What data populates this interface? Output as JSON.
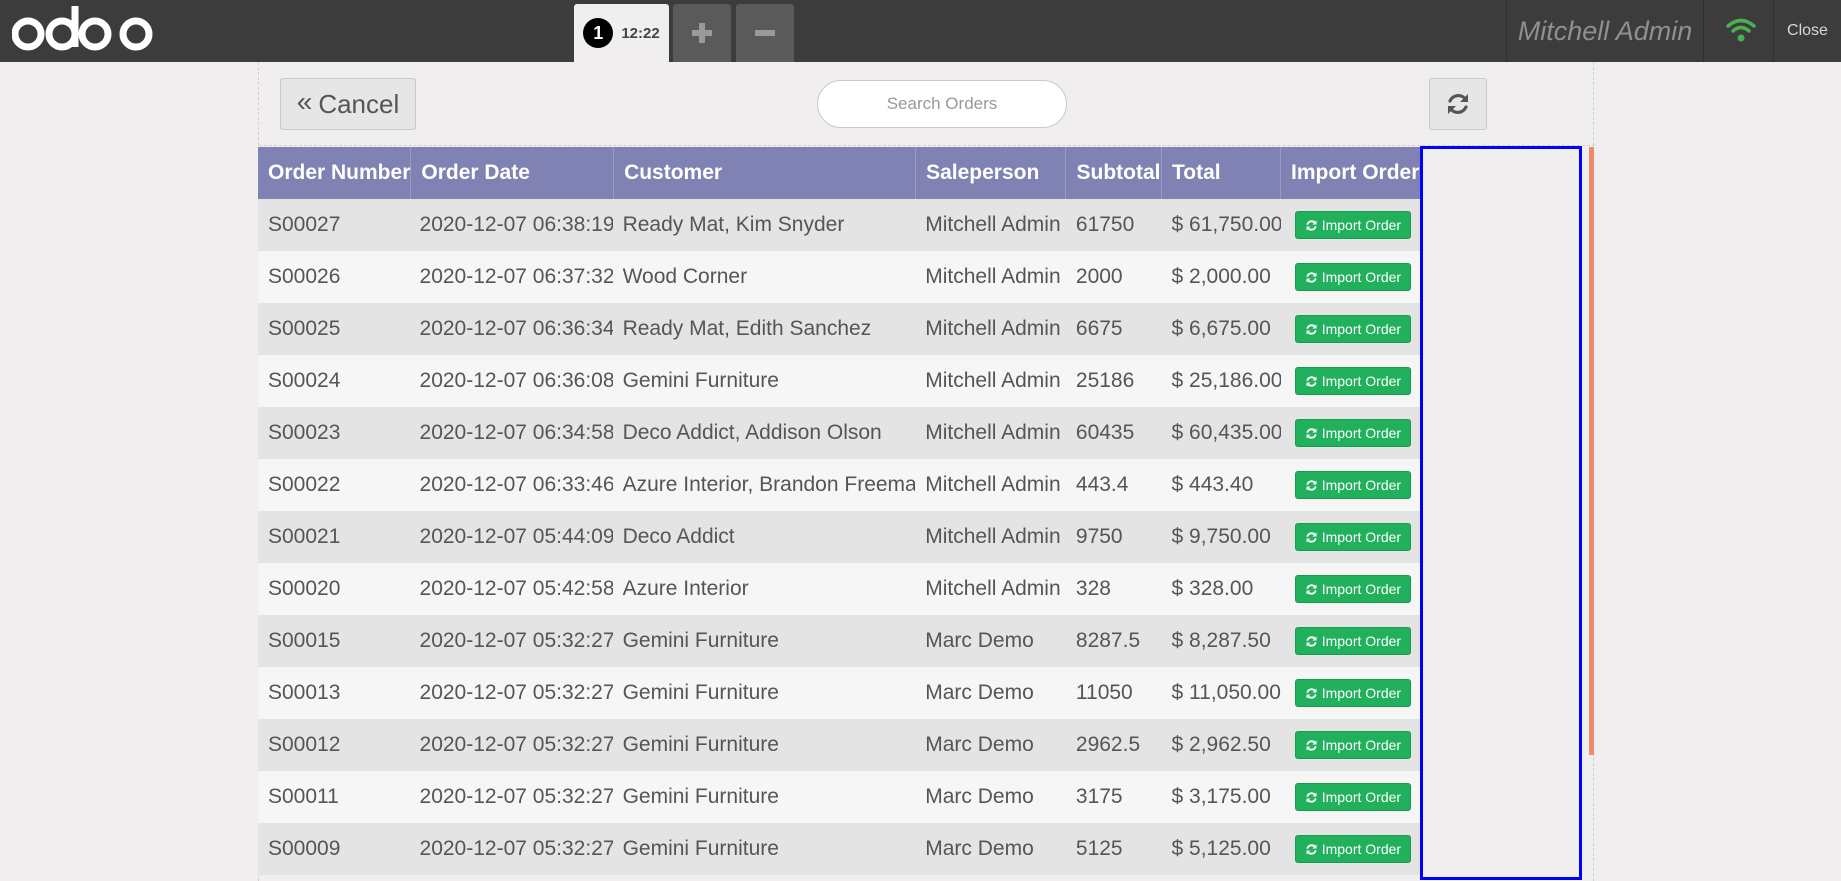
{
  "topbar": {
    "logo_icon": "odoo-logo-icon",
    "order_tab": {
      "number": "1",
      "time": "12:22"
    },
    "plus_icon": "plus-icon",
    "minus_icon": "minus-icon",
    "user_name": "Mitchell Admin",
    "wifi_icon": "wifi-icon",
    "wifi_color": "#4caf50",
    "close_label": "Close"
  },
  "controls": {
    "cancel_label": "Cancel",
    "search_placeholder": "Search Orders",
    "refresh_icon": "refresh-icon"
  },
  "table": {
    "header_color": "#7f82b2",
    "button_color": "#21b05b",
    "highlight_color": "#0000ff",
    "columns": [
      "Order Number",
      "Order Date",
      "Customer",
      "Saleperson",
      "Subtotal",
      "Total",
      "Import Order"
    ],
    "button_label": "Import Order",
    "rows": [
      {
        "number": "S00027",
        "date": "2020-12-07 06:38:19",
        "customer": "Ready Mat, Kim Snyder",
        "salesperson": "Mitchell Admin",
        "subtotal": "61750",
        "total": "$ 61,750.00"
      },
      {
        "number": "S00026",
        "date": "2020-12-07 06:37:32",
        "customer": "Wood Corner",
        "salesperson": "Mitchell Admin",
        "subtotal": "2000",
        "total": "$ 2,000.00"
      },
      {
        "number": "S00025",
        "date": "2020-12-07 06:36:34",
        "customer": "Ready Mat, Edith Sanchez",
        "salesperson": "Mitchell Admin",
        "subtotal": "6675",
        "total": "$ 6,675.00"
      },
      {
        "number": "S00024",
        "date": "2020-12-07 06:36:08",
        "customer": "Gemini Furniture",
        "salesperson": "Mitchell Admin",
        "subtotal": "25186",
        "total": "$ 25,186.00"
      },
      {
        "number": "S00023",
        "date": "2020-12-07 06:34:58",
        "customer": "Deco Addict, Addison Olson",
        "salesperson": "Mitchell Admin",
        "subtotal": "60435",
        "total": "$ 60,435.00"
      },
      {
        "number": "S00022",
        "date": "2020-12-07 06:33:46",
        "customer": "Azure Interior, Brandon Freeman",
        "salesperson": "Mitchell Admin",
        "subtotal": "443.4",
        "total": "$ 443.40"
      },
      {
        "number": "S00021",
        "date": "2020-12-07 05:44:09",
        "customer": "Deco Addict",
        "salesperson": "Mitchell Admin",
        "subtotal": "9750",
        "total": "$ 9,750.00"
      },
      {
        "number": "S00020",
        "date": "2020-12-07 05:42:58",
        "customer": "Azure Interior",
        "salesperson": "Mitchell Admin",
        "subtotal": "328",
        "total": "$ 328.00"
      },
      {
        "number": "S00015",
        "date": "2020-12-07 05:32:27",
        "customer": "Gemini Furniture",
        "salesperson": "Marc Demo",
        "subtotal": "8287.5",
        "total": "$ 8,287.50"
      },
      {
        "number": "S00013",
        "date": "2020-12-07 05:32:27",
        "customer": "Gemini Furniture",
        "salesperson": "Marc Demo",
        "subtotal": "11050",
        "total": "$ 11,050.00"
      },
      {
        "number": "S00012",
        "date": "2020-12-07 05:32:27",
        "customer": "Gemini Furniture",
        "salesperson": "Marc Demo",
        "subtotal": "2962.5",
        "total": "$ 2,962.50"
      },
      {
        "number": "S00011",
        "date": "2020-12-07 05:32:27",
        "customer": "Gemini Furniture",
        "salesperson": "Marc Demo",
        "subtotal": "3175",
        "total": "$ 3,175.00"
      },
      {
        "number": "S00009",
        "date": "2020-12-07 05:32:27",
        "customer": "Gemini Furniture",
        "salesperson": "Marc Demo",
        "subtotal": "5125",
        "total": "$ 5,125.00"
      }
    ]
  }
}
